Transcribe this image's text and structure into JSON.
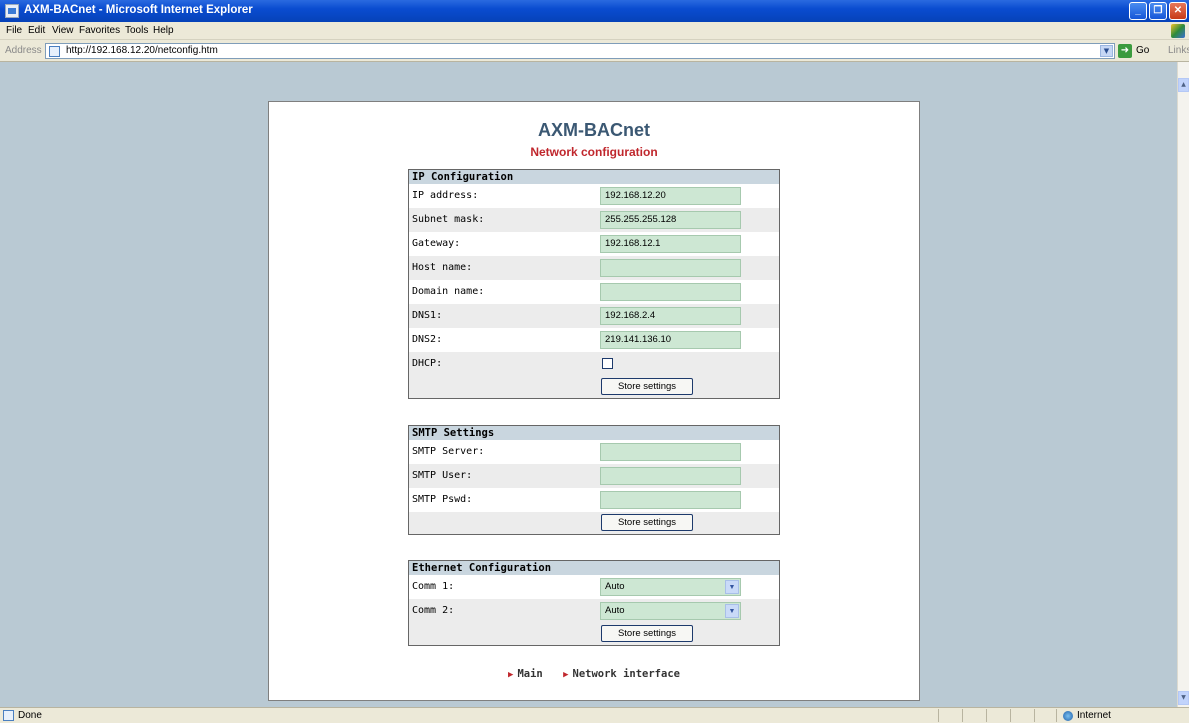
{
  "window": {
    "title": "AXM-BACnet - Microsoft Internet Explorer",
    "controls": [
      "_",
      "❐",
      "✕"
    ]
  },
  "menubar": {
    "items": [
      "File",
      "Edit",
      "View",
      "Favorites",
      "Tools",
      "Help"
    ]
  },
  "addressbar": {
    "label": "Address",
    "url": "http://192.168.12.20/netconfig.htm",
    "go_label": "Go",
    "links_label": "Links"
  },
  "page": {
    "title": "AXM-BACnet",
    "subtitle": "Network configuration"
  },
  "ip_config": {
    "header": "IP Configuration",
    "rows": [
      {
        "label": "IP address:",
        "value": "192.168.12.20"
      },
      {
        "label": "Subnet mask:",
        "value": "255.255.255.128"
      },
      {
        "label": "Gateway:",
        "value": "192.168.12.1"
      },
      {
        "label": "Host name:",
        "value": ""
      },
      {
        "label": "Domain name:",
        "value": ""
      },
      {
        "label": "DNS1:",
        "value": "192.168.2.4"
      },
      {
        "label": "DNS2:",
        "value": "219.141.136.10"
      }
    ],
    "dhcp_label": "DHCP:",
    "dhcp_checked": false,
    "store_label": "Store settings"
  },
  "smtp": {
    "header": "SMTP Settings",
    "rows": [
      {
        "label": "SMTP Server:",
        "value": ""
      },
      {
        "label": "SMTP User:",
        "value": ""
      },
      {
        "label": "SMTP Pswd:",
        "value": ""
      }
    ],
    "store_label": "Store settings"
  },
  "ethernet": {
    "header": "Ethernet Configuration",
    "rows": [
      {
        "label": "Comm 1:",
        "value": "Auto"
      },
      {
        "label": "Comm 2:",
        "value": "Auto"
      }
    ],
    "store_label": "Store settings"
  },
  "footer": {
    "links": [
      "Main",
      "Network interface"
    ]
  },
  "statusbar": {
    "status": "Done",
    "zone": "Internet"
  },
  "colors": {
    "accent_title": "#3b5873",
    "accent_subtitle": "#c0272d",
    "field_bg": "#cde7d3",
    "header_bg": "#c9d6df"
  }
}
